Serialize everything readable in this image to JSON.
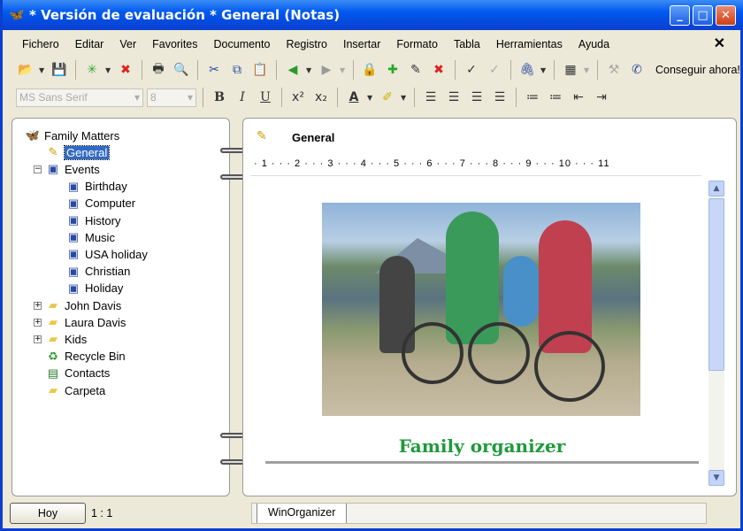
{
  "title": "* Versión de evaluación * General (Notas)",
  "menu": [
    "Fichero",
    "Editar",
    "Ver",
    "Favorites",
    "Documento",
    "Registro",
    "Insertar",
    "Formato",
    "Tabla",
    "Herramientas",
    "Ayuda"
  ],
  "toolbar": {
    "get_now": "Conseguir ahora!",
    "font_name": "MS Sans Serif",
    "font_size": "8"
  },
  "tree": [
    {
      "label": "Family Matters",
      "level": 0,
      "icon": "family-icon"
    },
    {
      "label": "General",
      "level": 1,
      "icon": "note-icon",
      "selected": true
    },
    {
      "label": "Events",
      "level": 1,
      "icon": "calendar-icon",
      "expanded": true
    },
    {
      "label": "Birthday",
      "level": 2,
      "icon": "calendar-icon"
    },
    {
      "label": "Computer",
      "level": 2,
      "icon": "calendar-icon"
    },
    {
      "label": "History",
      "level": 2,
      "icon": "calendar-icon"
    },
    {
      "label": "Music",
      "level": 2,
      "icon": "calendar-icon"
    },
    {
      "label": "USA holiday",
      "level": 2,
      "icon": "calendar-icon"
    },
    {
      "label": "Christian",
      "level": 2,
      "icon": "calendar-icon"
    },
    {
      "label": "Holiday",
      "level": 2,
      "icon": "calendar-icon"
    },
    {
      "label": "John Davis",
      "level": 1,
      "icon": "folder-icon",
      "collapsed": true
    },
    {
      "label": "Laura Davis",
      "level": 1,
      "icon": "folder-icon",
      "collapsed": true
    },
    {
      "label": "Kids",
      "level": 1,
      "icon": "folder-icon",
      "collapsed": true
    },
    {
      "label": "Recycle Bin",
      "level": 1,
      "icon": "recycle-bin-icon"
    },
    {
      "label": "Contacts",
      "level": 1,
      "icon": "contacts-icon"
    },
    {
      "label": "Carpeta",
      "level": 1,
      "icon": "folder-icon"
    }
  ],
  "note": {
    "title": "General",
    "ruler": "· 1 · · · 2 · · · 3 · · · 4 · · · 5 · · · 6 · · · 7 · · · 8 · · · 9 · · · 10 · · · 11",
    "heading": "Family organizer",
    "heading_color": "#1e9a3c"
  },
  "status": {
    "today_button": "Hoy",
    "position": "1 : 1",
    "tab": "WinOrganizer"
  }
}
